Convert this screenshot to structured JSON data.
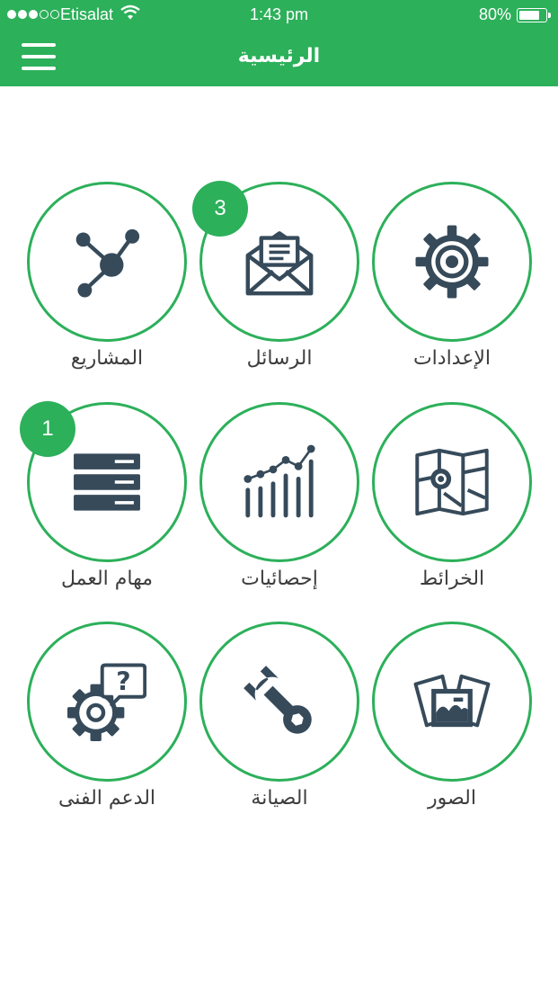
{
  "status_bar": {
    "carrier": "Etisalat",
    "time": "1:43 pm",
    "battery_percent": "80%",
    "battery_level": 0.8,
    "signal_bars_filled": 3,
    "signal_bars_total": 5
  },
  "nav": {
    "title": "الرئيسية",
    "menu_icon": "hamburger-menu-icon"
  },
  "colors": {
    "primary": "#2cb05a",
    "icon": "#364a5a",
    "label_text": "#3d3d3d"
  },
  "tiles": [
    {
      "label": "الإعدادات",
      "icon": "gear-icon",
      "badge": ""
    },
    {
      "label": "الرسائل",
      "icon": "envelope-letter-icon",
      "badge": "3"
    },
    {
      "label": "المشاريع",
      "icon": "network-nodes-icon",
      "badge": ""
    },
    {
      "label": "الخرائط",
      "icon": "map-pin-icon",
      "badge": ""
    },
    {
      "label": "إحصائيات",
      "icon": "bar-line-chart-icon",
      "badge": ""
    },
    {
      "label": "مهام العمل",
      "icon": "server-stack-icon",
      "badge": "1"
    },
    {
      "label": "الصور",
      "icon": "photos-icon",
      "badge": ""
    },
    {
      "label": "الصيانة",
      "icon": "wrench-icon",
      "badge": ""
    },
    {
      "label": "الدعم الفنى",
      "icon": "gear-question-icon",
      "badge": ""
    }
  ]
}
